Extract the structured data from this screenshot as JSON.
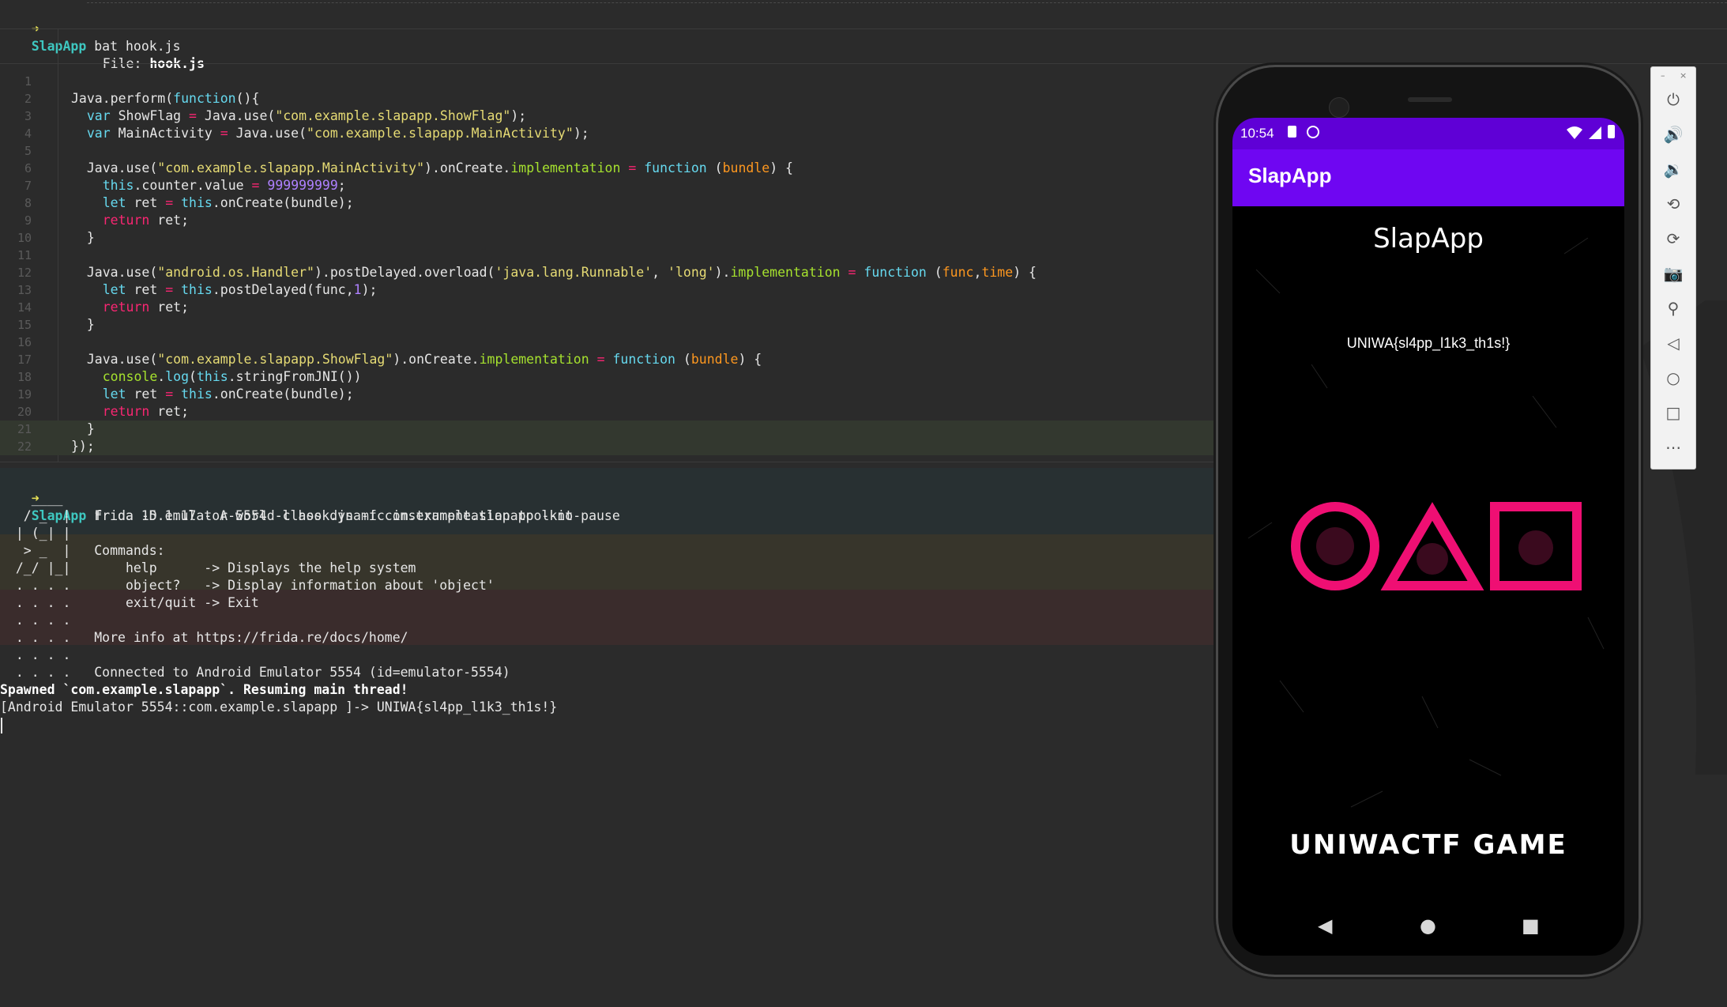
{
  "terminal": {
    "prompt_dir": "SlapApp",
    "prompt_arrow": "➜",
    "cmd1": " bat hook.js",
    "file_label": "File: ",
    "file_name": "hook.js",
    "line_numbers": [
      "1",
      "2",
      "3",
      "4",
      "5",
      "6",
      "7",
      "8",
      "9",
      "10",
      "11",
      "12",
      "13",
      "14",
      "15",
      "16",
      "17",
      "18",
      "19",
      "20",
      "21",
      "22"
    ],
    "code": {
      "l2a": "Java.perform(",
      "l2b": "function",
      "l2c": "(){",
      "l3a": "  ",
      "l3b": "var",
      "l3c": " ShowFlag ",
      "l3d": "=",
      "l3e": " Java.use(",
      "l3f": "\"com.example.slapapp.ShowFlag\"",
      "l3g": ");",
      "l4a": "  ",
      "l4b": "var",
      "l4c": " MainActivity ",
      "l4d": "=",
      "l4e": " Java.use(",
      "l4f": "\"com.example.slapapp.MainActivity\"",
      "l4g": ");",
      "l6a": "  Java.use(",
      "l6b": "\"com.example.slapapp.MainActivity\"",
      "l6c": ").onCreate.",
      "l6d": "implementation",
      "l6e": " = ",
      "l6f": "function",
      "l6g": " (",
      "l6h": "bundle",
      "l6i": ") {",
      "l7a": "    ",
      "l7b": "this",
      "l7c": ".counter.value ",
      "l7d": "=",
      "l7e": " ",
      "l7f": "999999999",
      "l7g": ";",
      "l8a": "    ",
      "l8b": "let",
      "l8c": " ret ",
      "l8d": "=",
      "l8e": " ",
      "l8f": "this",
      "l8g": ".onCreate(bundle);",
      "l9a": "    ",
      "l9b": "return",
      "l9c": " ret;",
      "l10": "  }",
      "l12a": "  Java.use(",
      "l12b": "\"android.os.Handler\"",
      "l12c": ").postDelayed.overload(",
      "l12d": "'java.lang.Runnable'",
      "l12e": ", ",
      "l12f": "'long'",
      "l12g": ").",
      "l12h": "implementation",
      "l12i": " = ",
      "l12j": "function",
      "l12k": " (",
      "l12l": "func",
      "l12m": ",",
      "l12n": "time",
      "l12o": ") {",
      "l13a": "    ",
      "l13b": "let",
      "l13c": " ret ",
      "l13d": "=",
      "l13e": " ",
      "l13f": "this",
      "l13g": ".postDelayed(func,",
      "l13h": "1",
      "l13i": ");",
      "l14a": "    ",
      "l14b": "return",
      "l14c": " ret;",
      "l15": "  }",
      "l17a": "  Java.use(",
      "l17b": "\"com.example.slapapp.ShowFlag\"",
      "l17c": ").onCreate.",
      "l17d": "implementation",
      "l17e": " = ",
      "l17f": "function",
      "l17g": " (",
      "l17h": "bundle",
      "l17i": ") {",
      "l18a": "    ",
      "l18b": "console",
      "l18c": ".",
      "l18d": "log",
      "l18e": "(",
      "l18f": "this",
      "l18g": ".stringFromJNI())",
      "l19a": "    ",
      "l19b": "let",
      "l19c": " ret ",
      "l19d": "=",
      "l19e": " ",
      "l19f": "this",
      "l19g": ".onCreate(bundle);",
      "l20a": "    ",
      "l20b": "return",
      "l20c": " ret;",
      "l21": "  }",
      "l22": "});"
    },
    "cmd2": " frida -D emulator-5554 -l hook.js -f com.example.slapapp --no-pause",
    "frida_lines": [
      "    ____",
      "   / _  |   Frida 15.1.17 - A world-class dynamic instrumentation toolkit",
      "  | (_| |",
      "   > _  |   Commands:",
      "  /_/ |_|       help      -> Displays the help system",
      "  . . . .       object?   -> Display information about 'object'",
      "  . . . .       exit/quit -> Exit",
      "  . . . .",
      "  . . . .   More info at https://frida.re/docs/home/",
      "  . . . .",
      "  . . . .   Connected to Android Emulator 5554 (id=emulator-5554)"
    ],
    "spawned": "Spawned `com.example.slapapp`. Resuming main thread!",
    "repl_line": "[Android Emulator 5554::com.example.slapapp ]-> UNIWA{sl4pp_l1k3_th1s!}"
  },
  "emulator": {
    "toolbar_minimize": "–",
    "toolbar_close": "×",
    "toolbar_icons": [
      "power-icon",
      "volume-up-icon",
      "volume-down-icon",
      "rotate-left-icon",
      "rotate-right-icon",
      "camera-icon",
      "zoom-icon",
      "back-icon",
      "home-icon",
      "overview-icon",
      "more-icon"
    ],
    "toolbar_glyphs": [
      "⏻",
      "🔊",
      "🔉",
      "⟲",
      "⟳",
      "📷",
      "⚲",
      "◁",
      "○",
      "□",
      "⋯"
    ]
  },
  "phone": {
    "time": "10:54",
    "app_bar_title": "SlapApp",
    "screen_title": "SlapApp",
    "flag": "UNIWA{sl4pp_l1k3_th1s!}",
    "logo_text": "UNIWACTF GAME",
    "nav_back": "◀",
    "nav_home": "●",
    "nav_recent": "■",
    "colors": {
      "status_bar": "#5f00d6",
      "app_bar": "#6f06f2",
      "shape_pink": "#ef0f73"
    }
  }
}
